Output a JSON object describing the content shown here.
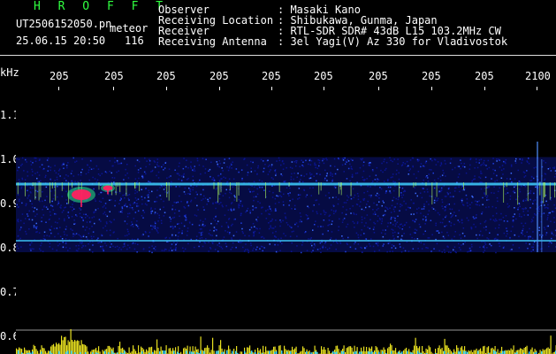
{
  "header": {
    "brand": "H R O F F T",
    "file_name": "UT2506152050.pn",
    "detection_type": "meteor",
    "date_time": "25.06.15 20:50",
    "count": "116",
    "info": [
      {
        "label": "Observer",
        "value": ": Masaki Kano"
      },
      {
        "label": "Receiving Location",
        "value": ": Shibukawa, Gunma, Japan"
      },
      {
        "label": "Receiver",
        "value": ": RTL-SDR SDR# 43dB L15 103.2MHz CW"
      },
      {
        "label": "Receiving Antenna",
        "value": ": 3el Yagi(V) Az 330 for Vladivostok"
      }
    ]
  },
  "chart_data": {
    "type": "heatmap",
    "ylabel": "kHz",
    "y_ticks": [
      "1.1",
      "1.0",
      "0.9",
      "0.8",
      "0.7",
      "0.6"
    ],
    "x_tick_labels": [
      "205",
      "205",
      "205",
      "205",
      "205",
      "205",
      "205",
      "205",
      "205",
      "2100"
    ],
    "ylim": [
      0.6,
      1.1
    ],
    "signal_lines_khz": [
      0.944,
      0.815
    ],
    "meteor_echoes": [
      {
        "x_index": 0.6,
        "khz": 0.92,
        "strength": 1.0
      },
      {
        "x_index": 1.1,
        "khz": 0.935,
        "strength": 0.5
      }
    ],
    "colors": {
      "noise": "#1020c0",
      "carrier": "#40d0ff",
      "meteor": "#ff2060",
      "activity": "#e8e020",
      "background": "#000000"
    }
  }
}
